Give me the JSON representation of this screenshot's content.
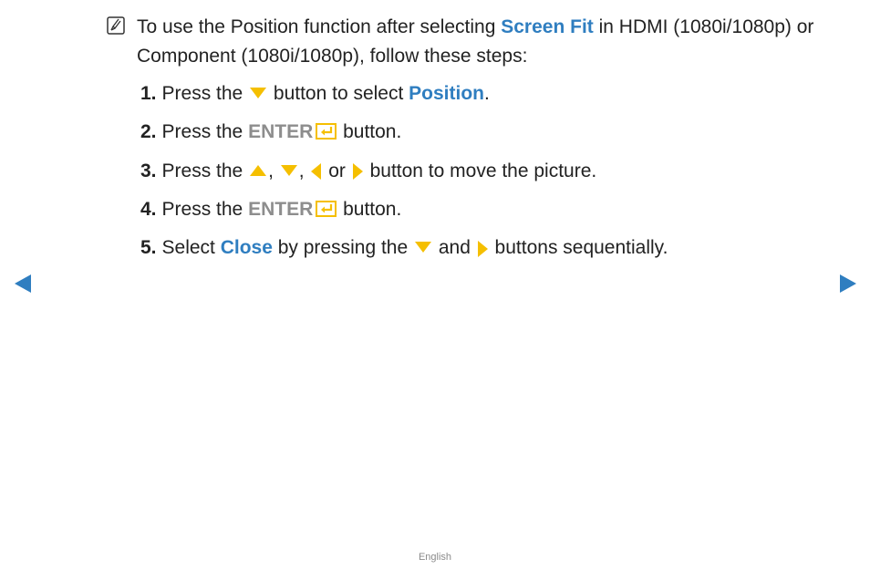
{
  "note": {
    "icon": "note-icon",
    "text_1": "To use the Position function after selecting ",
    "highlight_1": "Screen Fit",
    "text_2": " in HDMI (1080i/1080p) or Component (1080i/1080p), follow these steps:"
  },
  "steps": [
    {
      "num": "1.",
      "a": "Press the ",
      "b": " button to select ",
      "highlight": "Position",
      "c": "."
    },
    {
      "num": "2.",
      "a": "Press the ",
      "enter": "ENTER",
      "b": " button."
    },
    {
      "num": "3.",
      "a": "Press the ",
      "b": ", ",
      "c": ", ",
      "d": " or ",
      "e": " button to move the picture."
    },
    {
      "num": "4.",
      "a": "Press the ",
      "enter": "ENTER",
      "b": " button."
    },
    {
      "num": "5.",
      "a": "Select ",
      "highlight": "Close",
      "b": " by pressing the ",
      "c": " and ",
      "d": " buttons sequentially."
    }
  ],
  "navigation": {
    "prev_icon": "triangle-left-icon",
    "next_icon": "triangle-right-icon"
  },
  "footer": {
    "language": "English"
  },
  "colors": {
    "highlight": "#2f7ec0",
    "arrow": "#f5bf00",
    "enter_text": "#8d8d8d",
    "nav": "#2f7ec0"
  }
}
